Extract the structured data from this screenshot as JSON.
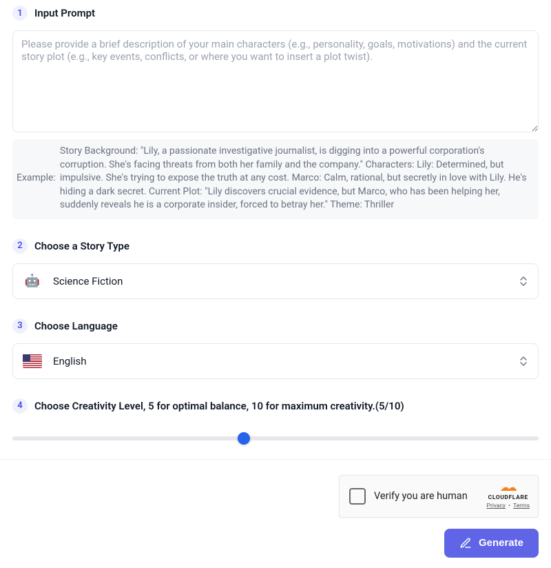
{
  "section1": {
    "step": "1",
    "title": "Input Prompt",
    "placeholder": "Please provide a brief description of your main characters (e.g., personality, goals, motivations) and the current story plot (e.g., key events, conflicts, or where you want to insert a plot twist).",
    "value": "",
    "example_label": "Example:",
    "example_text": "Story Background: \"Lily, a passionate investigative journalist, is digging into a powerful corporation's corruption. She's facing threats from both her family and the company.\" Characters: Lily: Determined, but impulsive. She's trying to expose the truth at any cost. Marco: Calm, rational, but secretly in love with Lily. He's hiding a dark secret. Current Plot: \"Lily discovers crucial evidence, but Marco, who has been helping her, suddenly reveals he is a corporate insider, forced to betray her.\" Theme: Thriller"
  },
  "section2": {
    "step": "2",
    "title": "Choose a Story Type",
    "icon": "🤖",
    "value": "Science Fiction"
  },
  "section3": {
    "step": "3",
    "title": "Choose Language",
    "value": "English"
  },
  "section4": {
    "step": "4",
    "title": "Choose Creativity Level, 5 for optimal balance, 10 for maximum creativity.(5/10)",
    "slider": {
      "min": 0,
      "max": 10,
      "value": 5,
      "percent": 44
    }
  },
  "captcha": {
    "label": "Verify you are human",
    "brand": "CLOUDFLARE",
    "privacy": "Privacy",
    "terms": "Terms"
  },
  "generate_label": "Generate"
}
